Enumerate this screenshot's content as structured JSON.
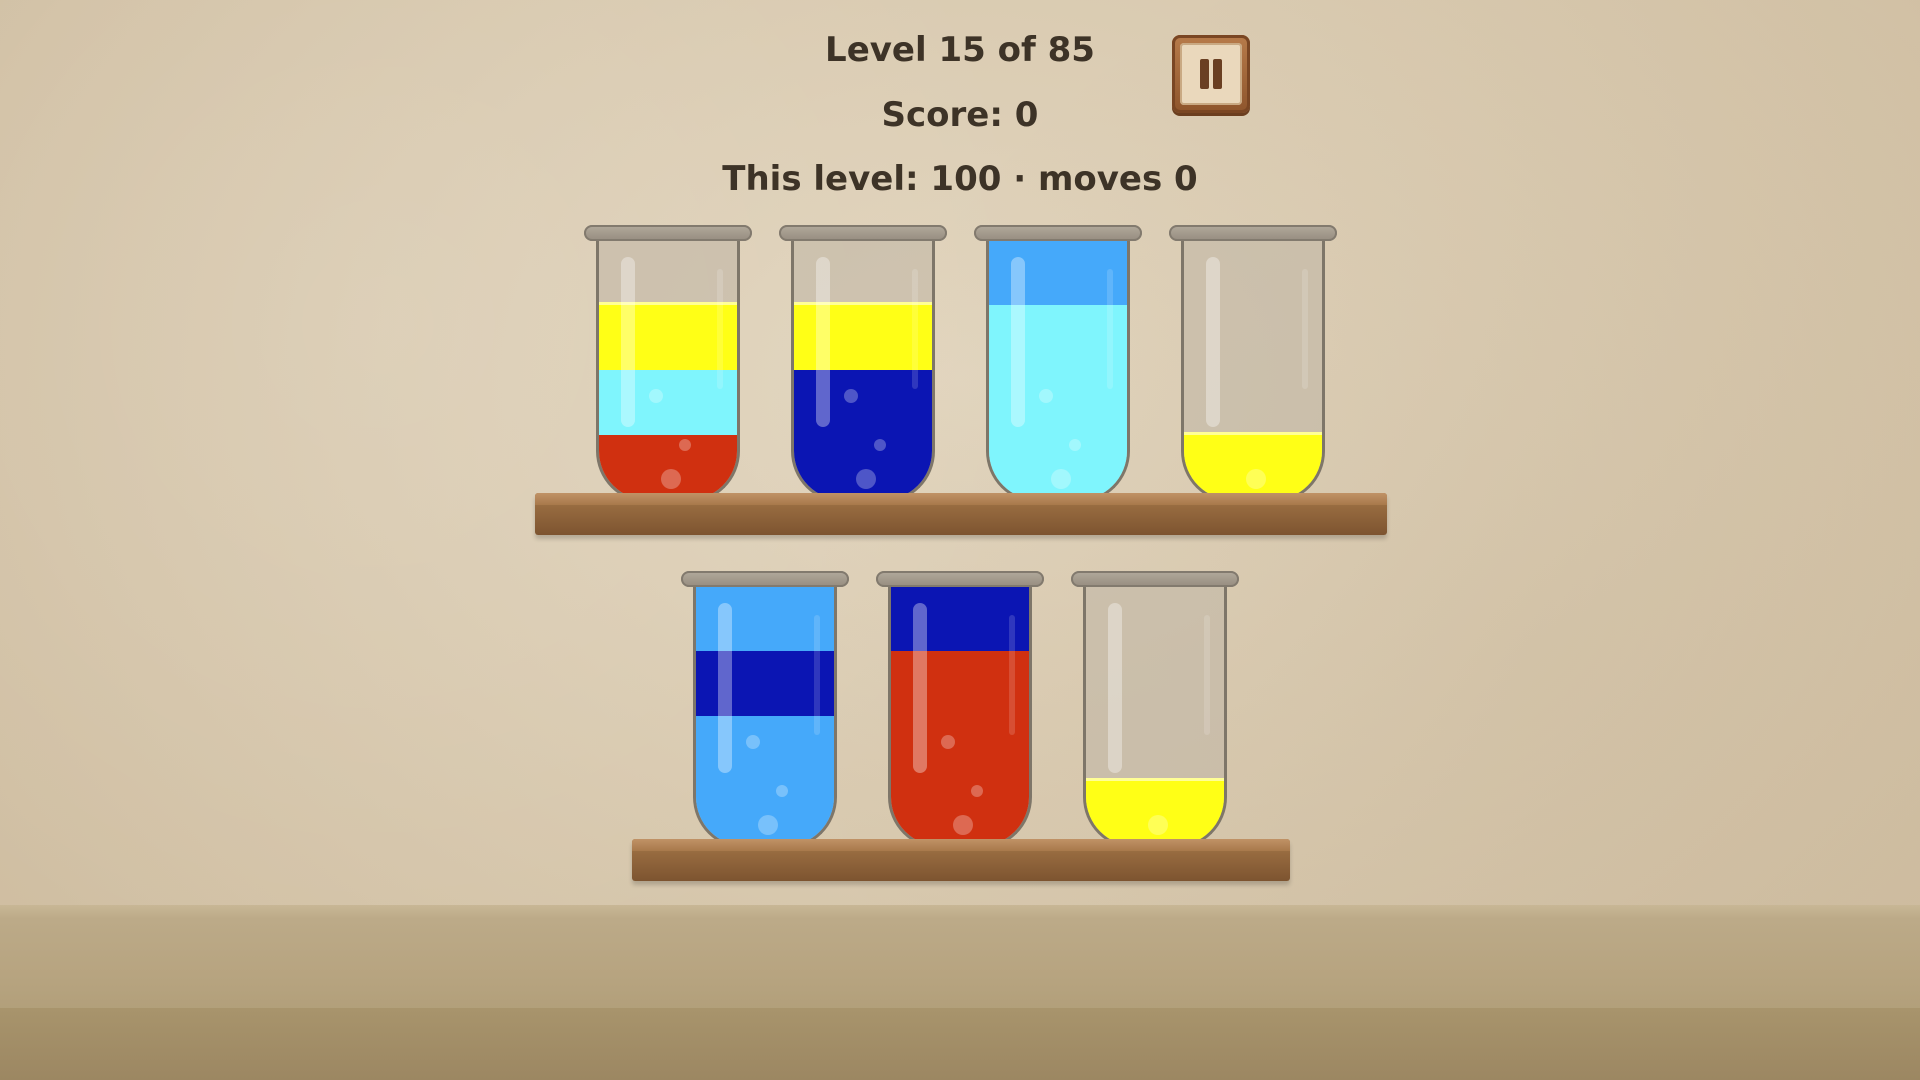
{
  "hud": {
    "level_text": "Level 15 of 85",
    "score_text": "Score: 0",
    "this_level_text": "This level: 100 · moves 0"
  },
  "colors": {
    "yellow": "#ffff16",
    "cyan": "#7ff5fd",
    "red": "#d03010",
    "navy": "#0b15b3",
    "skyblue": "#45a9fa"
  },
  "capacity": 4,
  "shelves": [
    {
      "tubes": [
        {
          "layers": [
            "red",
            "cyan",
            "yellow"
          ]
        },
        {
          "layers": [
            "navy",
            "navy",
            "yellow"
          ]
        },
        {
          "layers": [
            "cyan",
            "cyan",
            "cyan",
            "skyblue"
          ]
        },
        {
          "layers": [
            "yellow"
          ]
        }
      ]
    },
    {
      "tubes": [
        {
          "layers": [
            "skyblue",
            "skyblue",
            "navy",
            "skyblue"
          ]
        },
        {
          "layers": [
            "red",
            "red",
            "red",
            "navy"
          ]
        },
        {
          "layers": [
            "yellow"
          ]
        }
      ]
    }
  ]
}
